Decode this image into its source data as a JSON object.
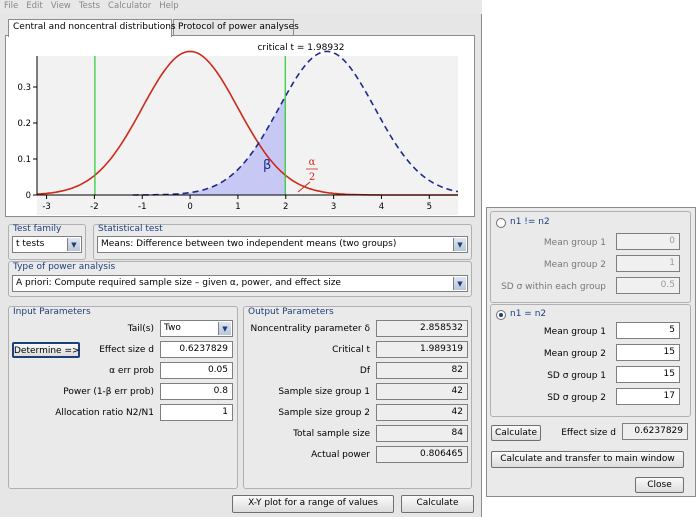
{
  "menu": [
    "File",
    "Edit",
    "View",
    "Tests",
    "Calculator",
    "Help"
  ],
  "tabs": [
    {
      "label": "Central and noncentral distributions",
      "active": true
    },
    {
      "label": "Protocol of power analyses",
      "active": false
    }
  ],
  "plot": {
    "critical_label": "critical t = 1.98932",
    "y_ticks": [
      "0.3",
      "0.2",
      "0.1",
      "0"
    ],
    "x_ticks": [
      "-3",
      "-2",
      "-1",
      "0",
      "1",
      "2",
      "3",
      "4",
      "5"
    ],
    "beta_label": "β",
    "alpha_num": "α",
    "alpha_den": "2",
    "colors": {
      "central": "#cc2a1a",
      "noncentral": "#1d2a8c",
      "critical": "#22cc33",
      "beta_fill": "#c8c8f4",
      "plot_bg": "#f2f2f2"
    }
  },
  "test_family": {
    "title": "Test family",
    "value": "t tests"
  },
  "statistical_test": {
    "title": "Statistical test",
    "value": "Means: Difference between two independent means (two groups)"
  },
  "analysis_type": {
    "title": "Type of power analysis",
    "value": "A priori: Compute required sample size – given α, power, and effect size"
  },
  "input": {
    "title": "Input Parameters",
    "tails_label": "Tail(s)",
    "tails_value": "Two",
    "determine_label": "Determine =>",
    "effect_label": "Effect size d",
    "effect_value": "0.6237829",
    "alpha_label": "α err prob",
    "alpha_value": "0.05",
    "power_label": "Power (1-β err prob)",
    "power_value": "0.8",
    "ratio_label": "Allocation ratio N2/N1",
    "ratio_value": "1"
  },
  "output": {
    "title": "Output Parameters",
    "rows": [
      {
        "label": "Noncentrality parameter δ",
        "value": "2.858532"
      },
      {
        "label": "Critical t",
        "value": "1.989319"
      },
      {
        "label": "Df",
        "value": "82"
      },
      {
        "label": "Sample size group 1",
        "value": "42"
      },
      {
        "label": "Sample size group 2",
        "value": "42"
      },
      {
        "label": "Total sample size",
        "value": "84"
      },
      {
        "label": "Actual power",
        "value": "0.806465"
      }
    ]
  },
  "buttons": {
    "xy_plot": "X-Y plot for a range of values",
    "calculate": "Calculate"
  },
  "side": {
    "unequal": {
      "title": "n1 != n2",
      "rows": [
        {
          "label": "Mean group 1",
          "value": "0"
        },
        {
          "label": "Mean group 2",
          "value": "1"
        },
        {
          "label": "SD σ within each group",
          "value": "0.5"
        }
      ]
    },
    "equal": {
      "title": "n1 = n2",
      "rows": [
        {
          "label": "Mean group 1",
          "value": "5"
        },
        {
          "label": "Mean group 2",
          "value": "15"
        },
        {
          "label": "SD σ group 1",
          "value": "15"
        },
        {
          "label": "SD σ group 2",
          "value": "17"
        }
      ]
    },
    "calculate_label": "Calculate",
    "effect_label": "Effect size d",
    "effect_value": "0.6237829",
    "transfer_label": "Calculate and transfer to main window",
    "close_label": "Close"
  }
}
